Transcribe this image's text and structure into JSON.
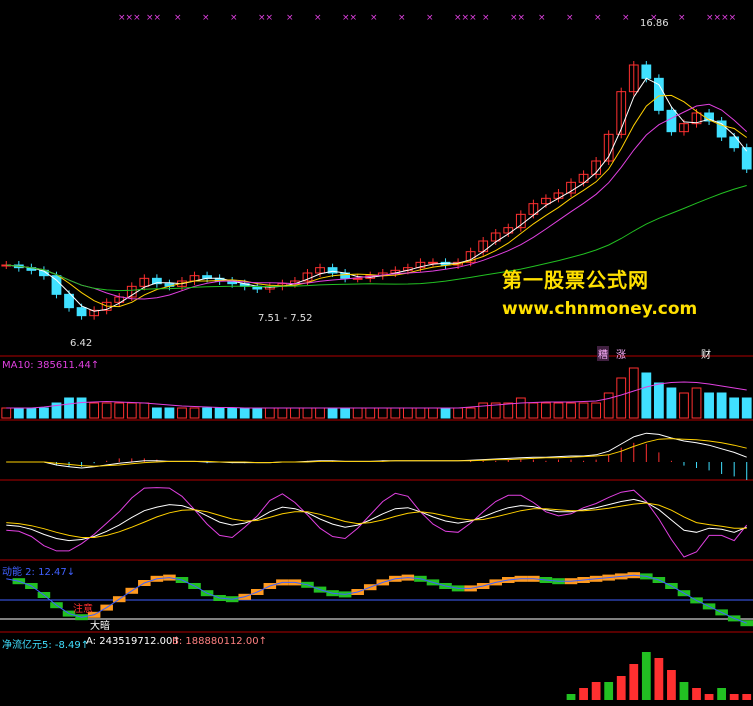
{
  "watermark": {
    "line1": "第一股票公式网",
    "line2": "www.chnmoney.com"
  },
  "colors": {
    "up": "#ff3030",
    "down": "#40e0ff",
    "ma5": "#ffffff",
    "ma10": "#ffd000",
    "ma20": "#e040e0",
    "ma60": "#22c022",
    "sep": "#b00000",
    "orange": "#ff9a20"
  },
  "main_panel": {
    "high_label": "16.86",
    "low_label": "6.42",
    "range_label": "7.51 - 7.52",
    "event_markers": [
      "×××",
      "××",
      "×",
      "×",
      "×",
      "××",
      "×",
      "×",
      "××",
      "×",
      "×",
      "×",
      "×××",
      "×",
      "××",
      "×",
      "×",
      "×",
      "×",
      "×",
      "×",
      "××××"
    ],
    "bottom_tags": [
      "糟",
      "涨",
      "财"
    ]
  },
  "volume_panel": {
    "label": "MA10: 385611.44↑"
  },
  "panel5": {
    "label": "动能 2: 12.47↓"
  },
  "annotations": {
    "note": "注意",
    "big_rise": "大暗"
  },
  "panel6": {
    "label": "净流亿元5: -8.49↑",
    "a_label": "A: 243519712.00↑",
    "b_label": "B: 188880112.00↑"
  },
  "chart_data": [
    {
      "type": "candlestick",
      "title": "",
      "ylim": [
        5.5,
        17.5
      ],
      "price_labels": {
        "high": 16.86,
        "low": 6.42
      },
      "close": [
        8.5,
        8.4,
        8.3,
        8.1,
        7.4,
        6.9,
        6.6,
        6.8,
        7.1,
        7.3,
        7.7,
        8.0,
        7.8,
        7.7,
        7.9,
        8.1,
        8.0,
        7.9,
        7.8,
        7.7,
        7.6,
        7.7,
        7.8,
        7.9,
        8.2,
        8.4,
        8.2,
        8.0,
        8.0,
        8.1,
        8.2,
        8.3,
        8.4,
        8.6,
        8.6,
        8.5,
        8.6,
        9.0,
        9.4,
        9.7,
        9.9,
        10.4,
        10.8,
        11.0,
        11.2,
        11.6,
        11.9,
        12.4,
        13.4,
        15.0,
        16.0,
        15.5,
        14.3,
        13.5,
        13.8,
        14.2,
        13.9,
        13.3,
        12.9,
        12.1
      ]
    },
    {
      "type": "bar",
      "title": "",
      "note": "volume",
      "values": [
        2,
        2,
        2,
        2,
        3,
        4,
        4,
        3,
        3,
        3,
        3,
        3,
        2,
        2,
        2,
        2,
        2,
        2,
        2,
        2,
        2,
        2,
        2,
        2,
        2,
        2,
        2,
        2,
        2,
        2,
        2,
        2,
        2,
        2,
        2,
        2,
        2,
        2,
        3,
        3,
        3,
        4,
        3,
        3,
        3,
        3,
        3,
        3,
        5,
        8,
        10,
        9,
        7,
        6,
        5,
        6,
        5,
        5,
        4,
        4
      ],
      "ma10": [
        2,
        2,
        2,
        2.2,
        2.5,
        2.8,
        3.1,
        3.2,
        3.3,
        3.2,
        3.1,
        3,
        2.8,
        2.6,
        2.4,
        2.3,
        2.2,
        2.1,
        2.1,
        2,
        2,
        2,
        2,
        2,
        2,
        2,
        2,
        2,
        2,
        2,
        2,
        2,
        2,
        2,
        2,
        2,
        2,
        2.2,
        2.4,
        2.6,
        2.8,
        3,
        3.1,
        3.2,
        3.2,
        3.2,
        3.3,
        3.4,
        3.9,
        4.6,
        5.4,
        6.2,
        6.8,
        7.1,
        7.2,
        7.1,
        6.8,
        6.4,
        6,
        5.6
      ]
    },
    {
      "type": "line",
      "title": "",
      "note": "oscillator (DIF / DEA / histogram)",
      "dif": [
        0,
        0,
        0,
        0,
        -0.05,
        -0.08,
        -0.1,
        -0.08,
        -0.05,
        -0.02,
        0,
        0.02,
        0.02,
        0.01,
        0.01,
        0.01,
        0,
        0,
        -0.01,
        -0.01,
        -0.01,
        -0.01,
        0,
        0,
        0.01,
        0.02,
        0.02,
        0.01,
        0.01,
        0.01,
        0.02,
        0.02,
        0.02,
        0.02,
        0.02,
        0.02,
        0.02,
        0.03,
        0.04,
        0.05,
        0.06,
        0.07,
        0.08,
        0.08,
        0.09,
        0.1,
        0.1,
        0.12,
        0.18,
        0.3,
        0.42,
        0.48,
        0.46,
        0.4,
        0.35,
        0.32,
        0.28,
        0.22,
        0.16,
        0.08
      ],
      "dea": [
        0,
        0,
        0,
        0,
        -0.02,
        -0.04,
        -0.06,
        -0.07,
        -0.06,
        -0.05,
        -0.03,
        -0.01,
        0,
        0.01,
        0.01,
        0.01,
        0.01,
        0,
        0,
        0,
        -0.01,
        -0.01,
        0,
        0,
        0,
        0.01,
        0.01,
        0.01,
        0.01,
        0.01,
        0.01,
        0.02,
        0.02,
        0.02,
        0.02,
        0.02,
        0.02,
        0.02,
        0.03,
        0.04,
        0.04,
        0.05,
        0.06,
        0.07,
        0.07,
        0.08,
        0.09,
        0.1,
        0.12,
        0.18,
        0.26,
        0.33,
        0.38,
        0.39,
        0.38,
        0.37,
        0.35,
        0.32,
        0.28,
        0.23
      ]
    },
    {
      "type": "line",
      "title": "",
      "note": "KDJ style oscillator",
      "k": [
        40,
        38,
        32,
        22,
        14,
        10,
        12,
        18,
        28,
        40,
        55,
        68,
        75,
        80,
        78,
        70,
        58,
        46,
        40,
        44,
        52,
        66,
        75,
        72,
        64,
        52,
        42,
        36,
        40,
        50,
        62,
        72,
        74,
        66,
        56,
        48,
        44,
        48,
        56,
        66,
        74,
        78,
        76,
        70,
        66,
        66,
        70,
        74,
        80,
        86,
        90,
        84,
        70,
        50,
        30,
        26,
        34,
        32,
        26,
        36
      ],
      "d": [
        45,
        43,
        39,
        33,
        26,
        20,
        16,
        16,
        20,
        27,
        36,
        46,
        56,
        64,
        69,
        70,
        66,
        59,
        52,
        48,
        49,
        55,
        62,
        66,
        66,
        61,
        54,
        47,
        43,
        45,
        50,
        57,
        63,
        66,
        63,
        58,
        53,
        50,
        51,
        56,
        62,
        68,
        72,
        72,
        70,
        68,
        68,
        70,
        73,
        77,
        81,
        83,
        79,
        69,
        56,
        45,
        41,
        38,
        34,
        34
      ],
      "j": [
        30,
        28,
        18,
        0,
        -10,
        -10,
        4,
        22,
        44,
        66,
        93,
        112,
        113,
        112,
        96,
        70,
        42,
        20,
        16,
        36,
        58,
        88,
        101,
        84,
        60,
        34,
        18,
        14,
        34,
        60,
        86,
        102,
        96,
        66,
        42,
        28,
        26,
        44,
        66,
        86,
        98,
        98,
        84,
        66,
        58,
        62,
        74,
        82,
        94,
        104,
        108,
        86,
        52,
        12,
        -22,
        -12,
        20,
        20,
        10,
        40
      ]
    },
    {
      "type": "line",
      "title": "",
      "note": "trend lines with orange/green stepped bands",
      "trend": [
        82,
        78,
        70,
        55,
        38,
        24,
        18,
        22,
        34,
        48,
        62,
        75,
        82,
        84,
        80,
        70,
        58,
        50,
        48,
        52,
        60,
        70,
        76,
        76,
        72,
        64,
        58,
        56,
        60,
        68,
        76,
        82,
        84,
        82,
        76,
        70,
        66,
        66,
        70,
        76,
        80,
        82,
        82,
        80,
        78,
        78,
        80,
        82,
        84,
        86,
        88,
        86,
        80,
        70,
        58,
        46,
        36,
        26,
        16,
        8
      ]
    },
    {
      "type": "bar",
      "title": "",
      "note": "net flow",
      "values": [
        0,
        0,
        0,
        0,
        0,
        0,
        0,
        0,
        0,
        0,
        0,
        0,
        0,
        0,
        0,
        0,
        0,
        0,
        0,
        0,
        0,
        0,
        0,
        0,
        0,
        0,
        0,
        0,
        0,
        0,
        0,
        0,
        0,
        0,
        0,
        0,
        0,
        0,
        0,
        0,
        0,
        0,
        0,
        0,
        0,
        1,
        2,
        3,
        3,
        4,
        6,
        8,
        7,
        5,
        3,
        2,
        1,
        2,
        1,
        1
      ]
    }
  ]
}
